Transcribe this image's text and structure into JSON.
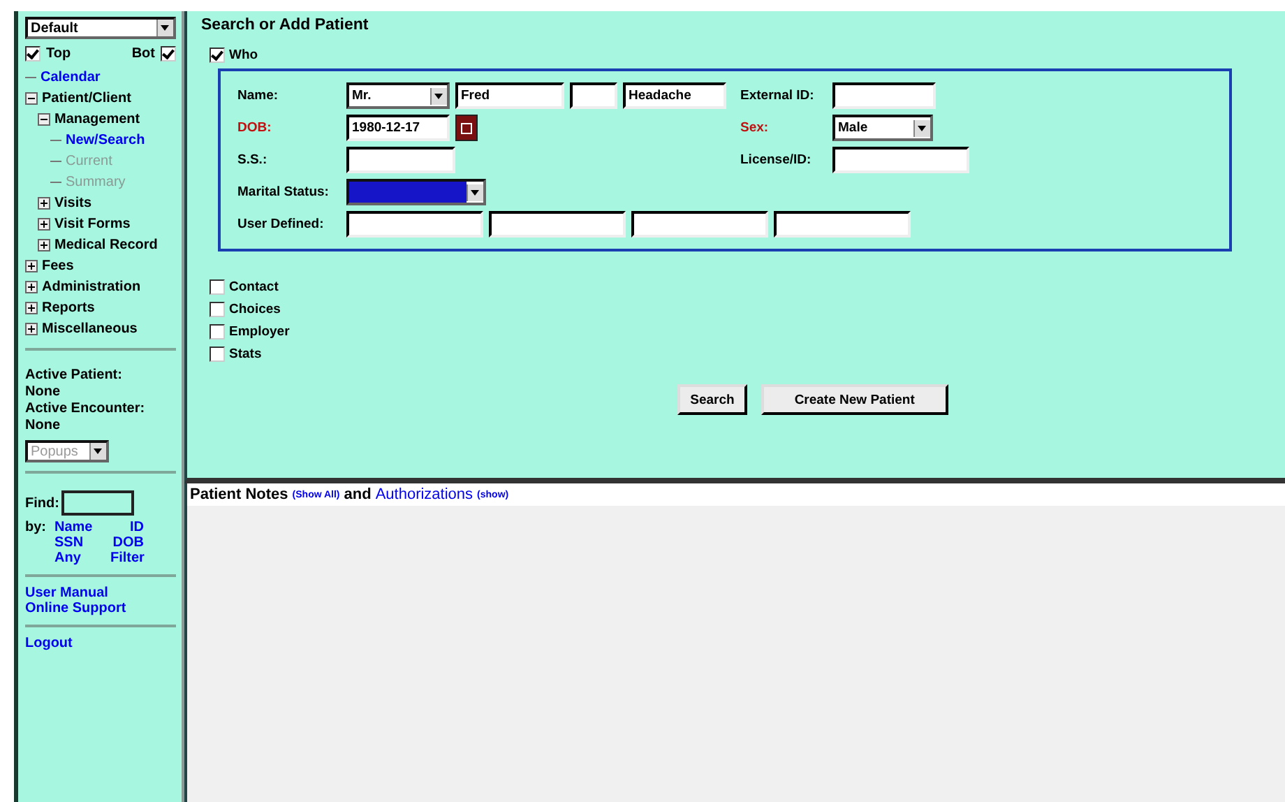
{
  "sidebar": {
    "view_select": "Default",
    "frames": [
      {
        "label": "Top",
        "checked": true
      },
      {
        "label": "Bot",
        "checked": true
      }
    ],
    "tree": [
      {
        "label": "Calendar",
        "kind": "link"
      },
      {
        "label": "Patient/Client",
        "kind": "folder",
        "expanded": true,
        "children": [
          {
            "label": "Management",
            "kind": "folder",
            "expanded": true,
            "children": [
              {
                "label": "New/Search",
                "kind": "link",
                "disabled": false
              },
              {
                "label": "Current",
                "kind": "link",
                "disabled": true
              },
              {
                "label": "Summary",
                "kind": "link",
                "disabled": true
              }
            ]
          },
          {
            "label": "Visits",
            "kind": "folder",
            "expanded": false
          },
          {
            "label": "Visit Forms",
            "kind": "folder",
            "expanded": false
          },
          {
            "label": "Medical Record",
            "kind": "folder",
            "expanded": false
          }
        ]
      },
      {
        "label": "Fees",
        "kind": "folder",
        "expanded": false
      },
      {
        "label": "Administration",
        "kind": "folder",
        "expanded": false
      },
      {
        "label": "Reports",
        "kind": "folder",
        "expanded": false
      },
      {
        "label": "Miscellaneous",
        "kind": "folder",
        "expanded": false
      }
    ],
    "active_patient_label": "Active Patient:",
    "active_patient": "None",
    "active_encounter_label": "Active Encounter:",
    "active_encounter": "None",
    "popups_select": "Popups",
    "find_label": "Find:",
    "by_label": "by:",
    "find_links": [
      "Name",
      "ID",
      "SSN",
      "DOB",
      "Any",
      "Filter"
    ],
    "help_links": [
      "User Manual",
      "Online Support"
    ],
    "logout": "Logout"
  },
  "main": {
    "title": "Search or Add Patient",
    "who": {
      "label": "Who",
      "checked": true
    },
    "name_label": "Name:",
    "title_select": "Mr.",
    "first_name": "Fred",
    "last_name": "Headache",
    "external_id_label": "External ID:",
    "dob_label": "DOB:",
    "dob_required": true,
    "dob": "1980-12-17",
    "sex_label": "Sex:",
    "sex_required": true,
    "sex": "Male",
    "ss_label": "S.S.:",
    "license_label": "License/ID:",
    "marital_label": "Marital Status:",
    "user_defined_label": "User Defined:",
    "sections": [
      {
        "label": "Contact",
        "checked": false
      },
      {
        "label": "Choices",
        "checked": false
      },
      {
        "label": "Employer",
        "checked": false
      },
      {
        "label": "Stats",
        "checked": false
      }
    ],
    "buttons": [
      "Search",
      "Create New Patient"
    ]
  },
  "notes": {
    "title": "Patient Notes",
    "notes_link": "(Show All)",
    "and": "and",
    "auth_title": "Authorizations",
    "auth_link": "(show)"
  }
}
